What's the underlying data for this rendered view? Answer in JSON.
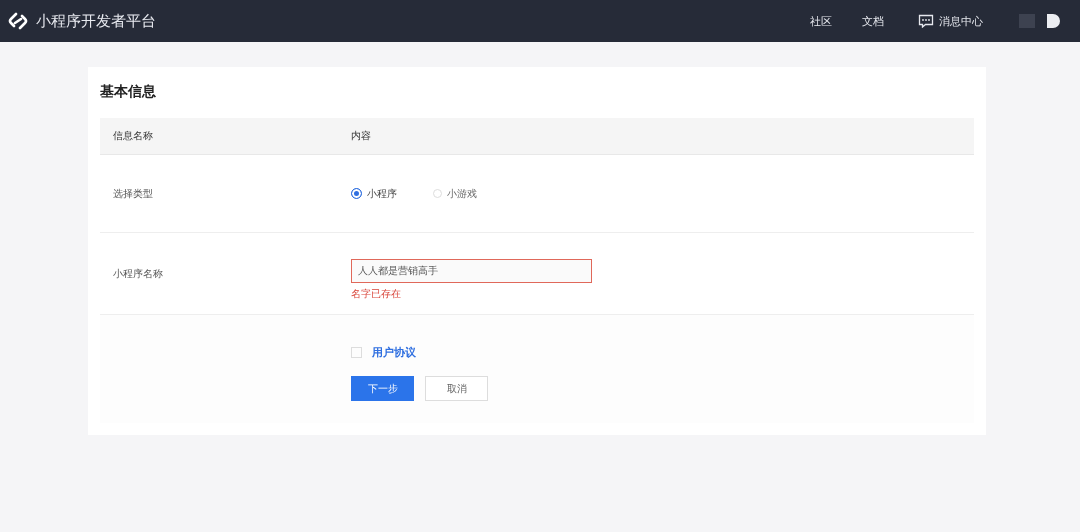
{
  "header": {
    "title": "小程序开发者平台",
    "nav": [
      "社区",
      "文档"
    ],
    "messages": "消息中心"
  },
  "card": {
    "title": "基本信息",
    "table": {
      "columns": [
        "信息名称",
        "内容"
      ],
      "type_row": {
        "label": "选择类型",
        "options": [
          {
            "label": "小程序",
            "selected": true
          },
          {
            "label": "小游戏",
            "selected": false
          }
        ]
      },
      "name_row": {
        "label": "小程序名称",
        "value": "人人都是营销高手",
        "error": "名字已存在"
      },
      "agreement": {
        "label": "用户协议",
        "checked": false
      },
      "buttons": [
        {
          "label": "下一步",
          "kind": "primary"
        },
        {
          "label": "取消",
          "kind": "default"
        }
      ]
    }
  }
}
